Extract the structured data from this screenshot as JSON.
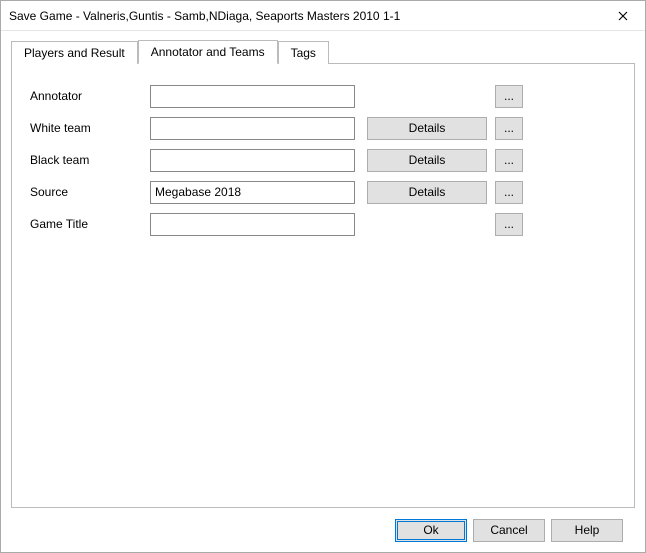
{
  "window": {
    "title": "Save Game - Valneris,Guntis - Samb,NDiaga, Seaports Masters 2010 1-1"
  },
  "tabs": {
    "items": [
      {
        "label": "Players and Result",
        "active": false
      },
      {
        "label": "Annotator and Teams",
        "active": true
      },
      {
        "label": "Tags",
        "active": false
      }
    ]
  },
  "form": {
    "rows": [
      {
        "label": "Annotator",
        "value": "",
        "details": false,
        "ellipsis": true
      },
      {
        "label": "White team",
        "value": "",
        "details": true,
        "ellipsis": true
      },
      {
        "label": "Black team",
        "value": "",
        "details": true,
        "ellipsis": true
      },
      {
        "label": "Source",
        "value": "Megabase 2018",
        "details": true,
        "ellipsis": true
      },
      {
        "label": "Game Title",
        "value": "",
        "details": false,
        "ellipsis": true
      }
    ],
    "details_label": "Details",
    "ellipsis_label": "..."
  },
  "footer": {
    "ok": "Ok",
    "cancel": "Cancel",
    "help": "Help"
  }
}
